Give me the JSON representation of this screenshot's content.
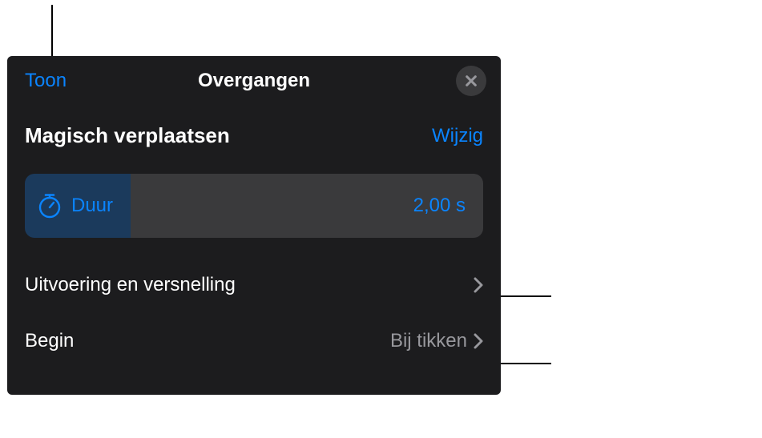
{
  "header": {
    "back_label": "Toon",
    "title": "Overgangen"
  },
  "section": {
    "title": "Magisch verplaatsen",
    "edit_label": "Wijzig"
  },
  "duration": {
    "label": "Duur",
    "value": "2,00 s"
  },
  "rows": {
    "execution": {
      "label": "Uitvoering en versnelling"
    },
    "begin": {
      "label": "Begin",
      "value": "Bij tikken"
    }
  },
  "colors": {
    "accent": "#0a84ff",
    "panel_bg": "#1c1c1e",
    "cell_bg": "#3a3a3c",
    "duration_left_bg": "#1b3a5c",
    "muted_text": "#98989d"
  }
}
